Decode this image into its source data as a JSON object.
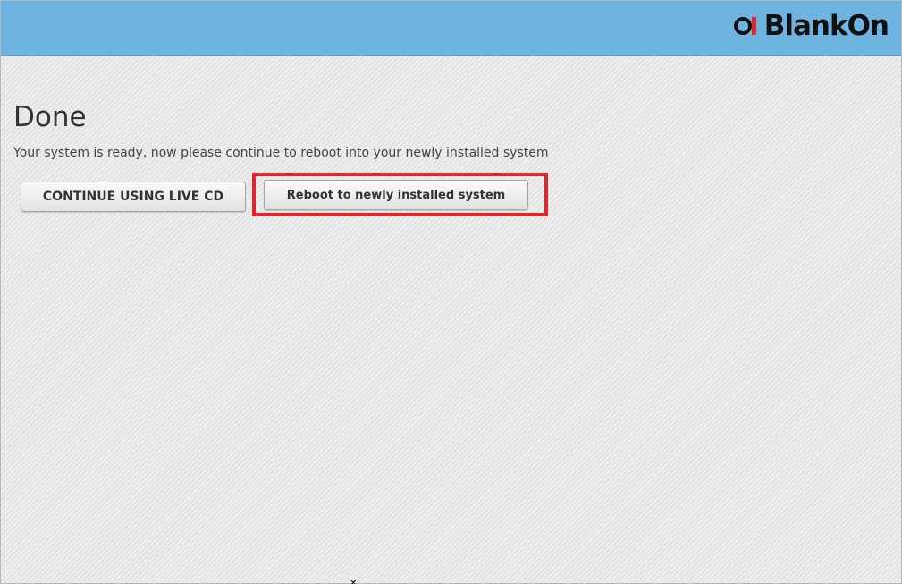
{
  "header": {
    "logo_text": "BlankOn",
    "background_color": "#6fb4e1",
    "logo_accent_color": "#e8242a"
  },
  "main": {
    "title": "Done",
    "subtitle": "Your system is ready, now please continue to reboot into your newly installed system"
  },
  "buttons": {
    "continue_live_label": "CONTINUE USING LIVE CD",
    "reboot_label": "Reboot to newly installed system"
  },
  "annotation": {
    "highlight_color": "#e3242b"
  },
  "cursor": {
    "icon": "pointer-cursor-icon"
  }
}
